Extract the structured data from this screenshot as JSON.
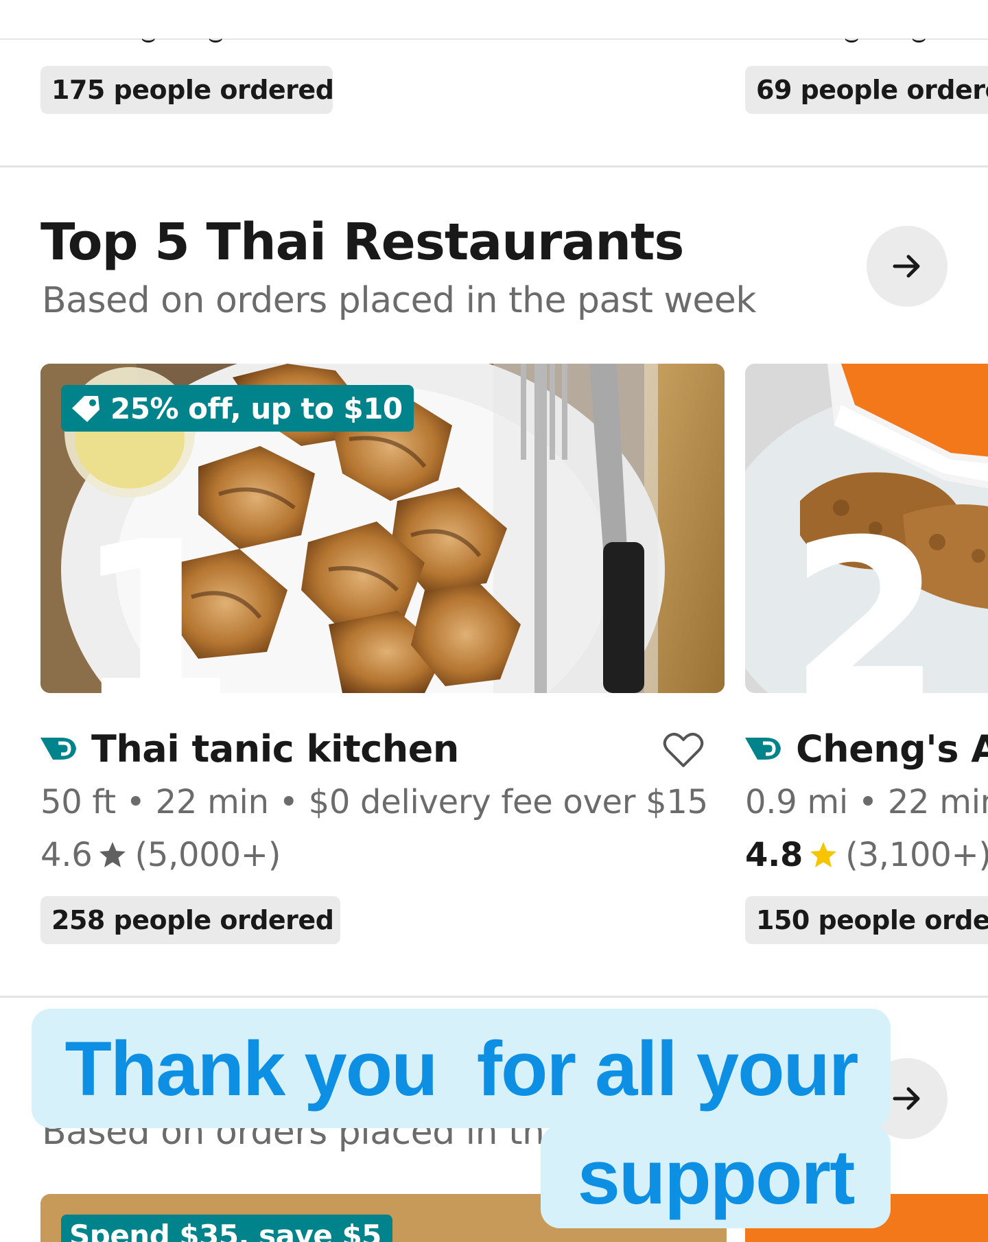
{
  "colors": {
    "accent_teal": "#00838a",
    "star_gold": "#f6c500",
    "star_gray": "#606060",
    "overlay_text": "#0d8fe3",
    "overlay_bg": "#d7f1fb"
  },
  "prev_section": {
    "card1_pill": "175 people ordered",
    "card2_pill": "69 people ordere"
  },
  "top_section": {
    "title": "Top 5 Thai Restaurants",
    "subtitle": "Based on orders placed in the past week",
    "arrow_icon": "arrow-right-icon",
    "cards": [
      {
        "rank": "1",
        "promo": "25% off, up to $10",
        "name": "Thai tanic kitchen",
        "meta": "50 ft • 22 min • $0 delivery fee over $15",
        "rating": "4.6",
        "reviews": "(5,000+)",
        "ordered": "258 people ordered"
      },
      {
        "rank": "2",
        "name": "Cheng's A",
        "meta": "0.9 mi • 22 min",
        "rating": "4.8",
        "reviews": "(3,100+)",
        "ordered": "150 people order"
      }
    ]
  },
  "next_section": {
    "subtitle_partial": "Based on orders placed in th",
    "badge_partial": "Spend $35, save $5"
  },
  "overlay": {
    "line1": "Thank you  for all your",
    "line2": "support"
  }
}
